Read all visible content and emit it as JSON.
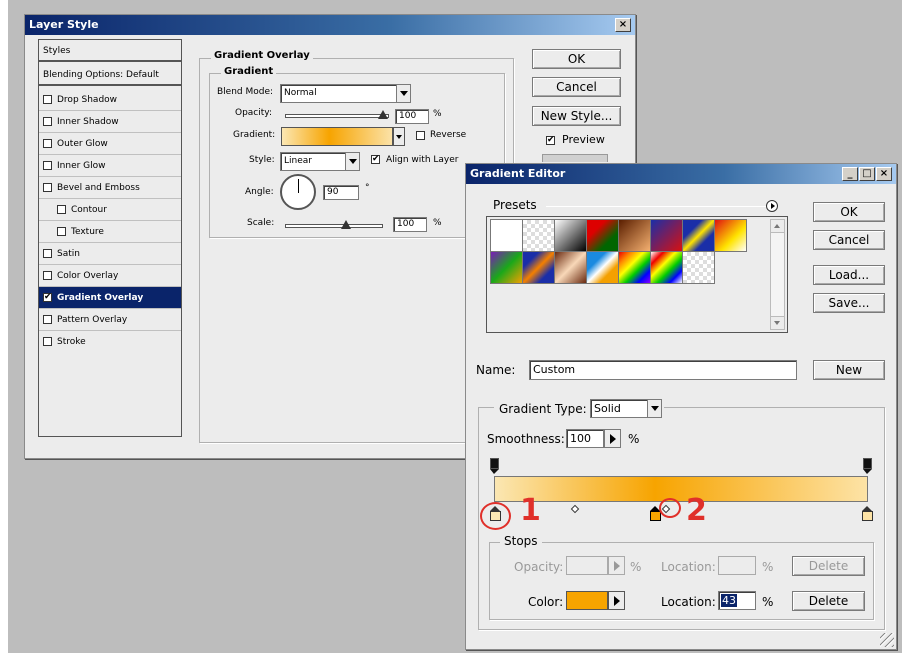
{
  "layer_style": {
    "title": "Layer Style",
    "close": "×",
    "styles_list": [
      "Styles",
      "Blending Options: Default",
      "Drop Shadow",
      "Inner Shadow",
      "Outer Glow",
      "Inner Glow",
      "Bevel and Emboss",
      "Contour",
      "Texture",
      "Satin",
      "Color Overlay",
      "Gradient Overlay",
      "Pattern Overlay",
      "Stroke"
    ],
    "section_title": "Gradient Overlay",
    "group_title": "Gradient",
    "blend_mode_label": "Blend Mode:",
    "blend_mode_value": "Normal",
    "opacity_label": "Opacity:",
    "opacity_value": "100",
    "opacity_unit": "%",
    "gradient_label": "Gradient:",
    "reverse_label": "Reverse",
    "style_label": "Style:",
    "style_value": "Linear",
    "align_label": "Align with Layer",
    "angle_label": "Angle:",
    "angle_value": "90",
    "angle_unit": "°",
    "scale_label": "Scale:",
    "scale_value": "100",
    "scale_unit": "%",
    "ok": "OK",
    "cancel": "Cancel",
    "new_style": "New Style...",
    "preview_label": "Preview"
  },
  "gradient_editor": {
    "title": "Gradient Editor",
    "minimize": "_",
    "maximize": "□",
    "close": "×",
    "presets_label": "Presets",
    "ok": "OK",
    "cancel": "Cancel",
    "load": "Load...",
    "save": "Save...",
    "name_label": "Name:",
    "name_value": "Custom",
    "new": "New",
    "gradient_type_label": "Gradient Type:",
    "gradient_type_value": "Solid",
    "smoothness_label": "Smoothness:",
    "smoothness_value": "100",
    "smoothness_unit": "%",
    "stops_label": "Stops",
    "opacity_label": "Opacity:",
    "opacity_unit": "%",
    "location_label": "Location:",
    "location_unit": "%",
    "delete": "Delete",
    "color_label": "Color:",
    "color_location_value": "43",
    "annotation_1": "1",
    "annotation_2": "2"
  },
  "colors": {
    "accent_orange": "#f7a400",
    "annotation_red": "#e0302a",
    "selection_navy": "#0a246a"
  }
}
